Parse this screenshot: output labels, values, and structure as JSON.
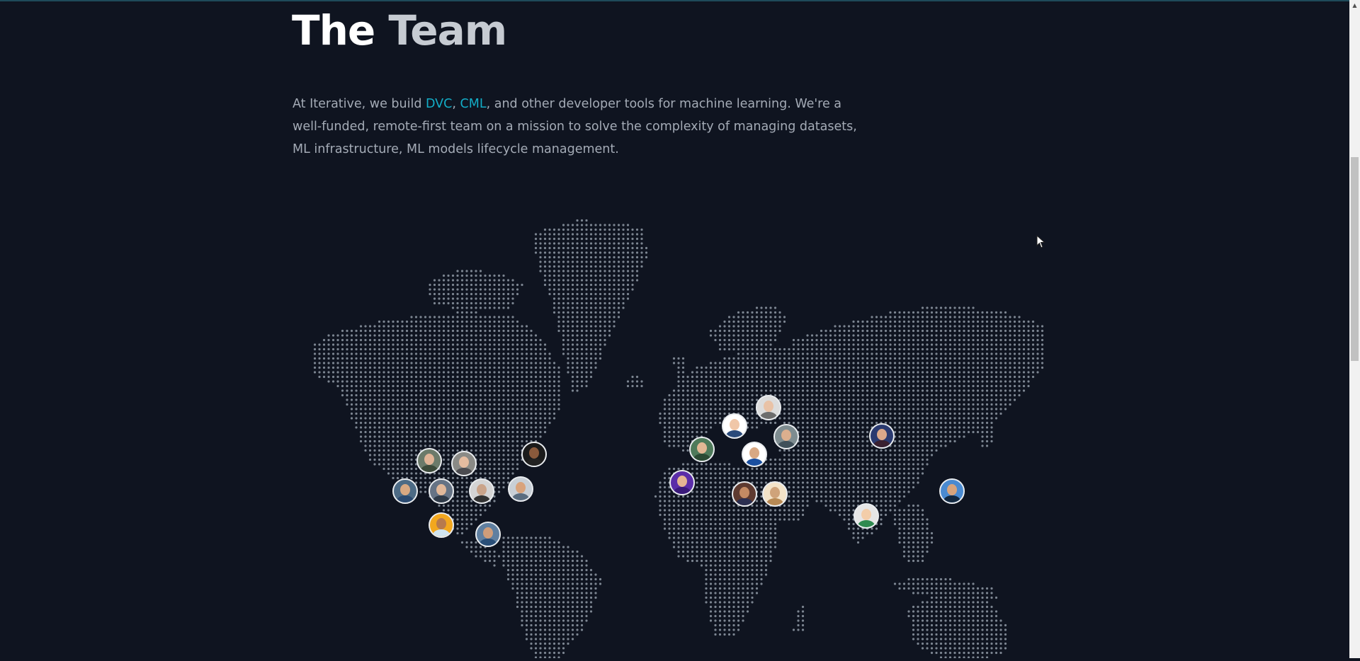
{
  "title": {
    "word1": "The",
    "word2": "Team"
  },
  "intro": {
    "part1": "At Iterative, we build ",
    "link1": "DVC",
    "sep": ", ",
    "link2": "CML",
    "part2": ", and other developer tools for machine learning. We're a well-funded, remote-first team on a mission to solve the complexity of managing datasets, ML infrastructure, ML models lifecycle management."
  },
  "colors": {
    "background": "#0f1420",
    "dots": "#7c8591",
    "link": "#13adc7",
    "heading": "#ffffff",
    "text": "#a4abb6"
  },
  "map": {
    "icon": "world-dot-map"
  },
  "team_members": [
    {
      "name": "member-1",
      "region": "north-america",
      "bg": "#6b7a6a",
      "skin": "#e0b497",
      "shirt": "#3c4a3a"
    },
    {
      "name": "member-2",
      "region": "north-america",
      "bg": "#8a8a86",
      "skin": "#e5bca0",
      "shirt": "#4b4b50"
    },
    {
      "name": "member-3",
      "region": "north-america",
      "bg": "#1b1b1b",
      "skin": "#8a5a3c",
      "shirt": "#222222"
    },
    {
      "name": "member-4",
      "region": "north-america",
      "bg": "#4d6b85",
      "skin": "#d9a982",
      "shirt": "#2b4a70"
    },
    {
      "name": "member-5",
      "region": "north-america",
      "bg": "#667385",
      "skin": "#e1b89a",
      "shirt": "#2f3a48"
    },
    {
      "name": "member-6",
      "region": "north-america",
      "bg": "#d4d4d4",
      "skin": "#caa48a",
      "shirt": "#333333"
    },
    {
      "name": "member-7",
      "region": "north-america",
      "bg": "#c8cfd6",
      "skin": "#d9a37c",
      "shirt": "#5a6d80"
    },
    {
      "name": "member-8",
      "region": "north-america",
      "bg": "#f2a71e",
      "skin": "#b77a4d",
      "shirt": "#d0e4f0"
    },
    {
      "name": "member-9",
      "region": "south-america",
      "bg": "#5f7fa0",
      "skin": "#cf9d7a",
      "shirt": "#2a4f78"
    },
    {
      "name": "member-10",
      "region": "europe",
      "bg": "#dcdcdc",
      "skin": "#e9c2a6",
      "shirt": "#6d6d6d"
    },
    {
      "name": "member-11",
      "region": "europe",
      "bg": "#ffffff",
      "skin": "#f0c7a8",
      "shirt": "#2a4a7a"
    },
    {
      "name": "member-12",
      "region": "europe",
      "bg": "#7e8c90",
      "skin": "#dcaf8e",
      "shirt": "#40505a"
    },
    {
      "name": "member-13",
      "region": "europe",
      "bg": "#4e7a5a",
      "skin": "#e2b794",
      "shirt": "#2c4a34"
    },
    {
      "name": "member-14",
      "region": "europe",
      "bg": "#ffffff",
      "skin": "#d8a883",
      "shirt": "#1a4fa0"
    },
    {
      "name": "member-15",
      "region": "europe",
      "bg": "#5b2da8",
      "skin": "#e5b593",
      "shirt": "#3a1a7a"
    },
    {
      "name": "member-16",
      "region": "middle-east",
      "bg": "#5e3a30",
      "skin": "#c48a63",
      "shirt": "#2b2e50"
    },
    {
      "name": "member-17",
      "region": "middle-east",
      "bg": "#f3e3c8",
      "skin": "#cfa37a",
      "shirt": "#b88a55"
    },
    {
      "name": "member-18",
      "region": "asia",
      "bg": "#2a3a70",
      "skin": "#dba88a",
      "shirt": "#3a2030"
    },
    {
      "name": "member-19",
      "region": "asia",
      "bg": "#e6e6e6",
      "skin": "#f3cda9",
      "shirt": "#2f8a50"
    },
    {
      "name": "member-20",
      "region": "asia",
      "bg": "#4a8ad0",
      "skin": "#d8a47c",
      "shirt": "#13283f"
    }
  ]
}
